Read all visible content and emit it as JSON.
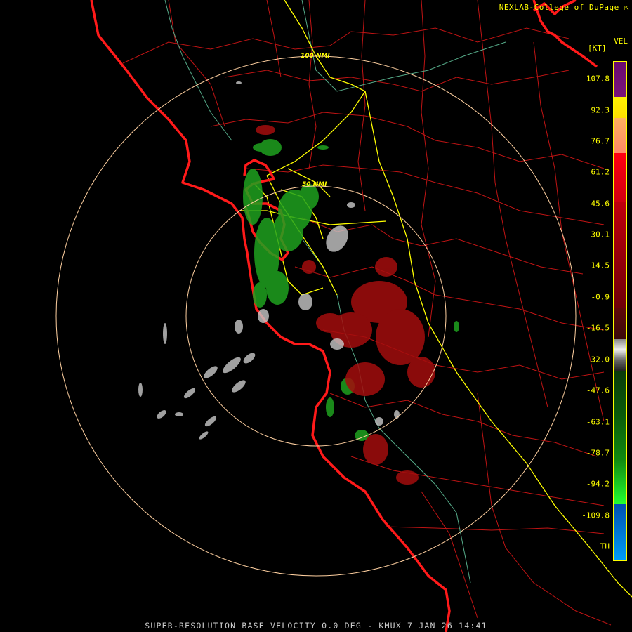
{
  "credit": "NEXLAB-College of DuPage",
  "credit_icon": "arrow-icon",
  "legend": {
    "variable": "VEL",
    "unit": "[KT]",
    "labels": [
      "107.8",
      "92.3",
      "76.7",
      "61.2",
      "45.6",
      "30.1",
      "14.5",
      "-0.9",
      "-16.5",
      "-32.0",
      "-47.6",
      "-63.1",
      "-78.7",
      "-94.2",
      "-109.8",
      "TH"
    ]
  },
  "range_rings": {
    "inner_label": "50 NMI",
    "outer_label": "100 NMI"
  },
  "footer": "SUPER-RESOLUTION BASE VELOCITY 0.0 DEG - KMUX 7 JAN 26 14:41",
  "colors": {
    "coastline": "#ff1a1a",
    "county_borders": "#c01414",
    "highways": "#ffff00",
    "rivers": "#55aa88",
    "range_rings": "#ffd0a0",
    "background": "#000000",
    "inbound": "#1fa21f",
    "outbound": "#a30d0d",
    "near_zero": "#c8c8c8"
  }
}
